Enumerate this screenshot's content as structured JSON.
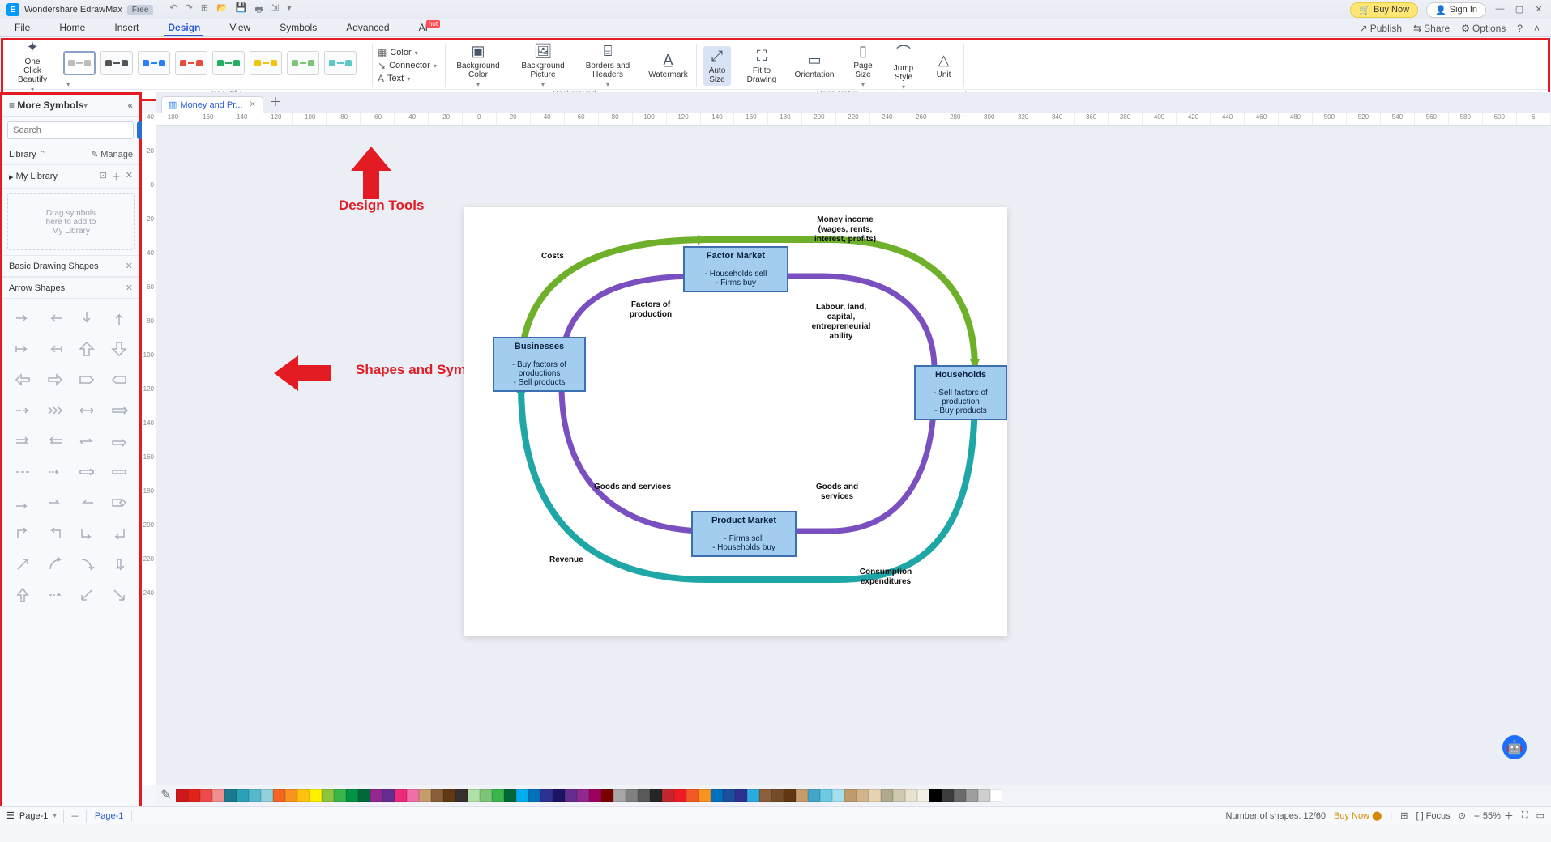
{
  "titlebar": {
    "app_name": "Wondershare EdrawMax",
    "free_badge": "Free",
    "buy_now": "Buy Now",
    "sign_in": "Sign In"
  },
  "menubar": {
    "items": [
      "File",
      "Home",
      "Insert",
      "Design",
      "View",
      "Symbols",
      "Advanced",
      "AI"
    ],
    "active_index": 3,
    "hot_index": 7,
    "right": {
      "publish": "Publish",
      "share": "Share",
      "options": "Options"
    }
  },
  "ribbon": {
    "one_click": "One Click\nBeautify",
    "color": "Color",
    "connector": "Connector",
    "text": "Text",
    "background_color": "Background\nColor",
    "background_picture": "Background\nPicture",
    "borders_headers": "Borders and\nHeaders",
    "watermark": "Watermark",
    "auto_size": "Auto\nSize",
    "fit_drawing": "Fit to\nDrawing",
    "orientation": "Orientation",
    "page_size": "Page\nSize",
    "jump_style": "Jump\nStyle",
    "unit": "Unit",
    "group_labels": {
      "beautify": "Beautify",
      "background": "Background",
      "page_setup": "Page Setup"
    }
  },
  "side_panel": {
    "title": "More Symbols",
    "search_placeholder": "Search",
    "search_btn": "Search",
    "library": "Library",
    "manage": "Manage",
    "my_library": "My Library",
    "drop_hint": "Drag symbols\nhere to add to\nMy Library",
    "basic_shapes": "Basic Drawing Shapes",
    "arrow_shapes": "Arrow Shapes"
  },
  "tabs": {
    "doc_name": "Money and Pr..."
  },
  "hruler_vals": [
    "180",
    "-160",
    "-140",
    "-120",
    "-100",
    "-80",
    "-60",
    "-40",
    "-20",
    "0",
    "20",
    "40",
    "60",
    "80",
    "100",
    "120",
    "140",
    "160",
    "180",
    "200",
    "220",
    "240",
    "260",
    "280",
    "300",
    "320",
    "340",
    "360",
    "380",
    "400",
    "420",
    "440",
    "460",
    "480",
    "500",
    "520",
    "540",
    "560",
    "580",
    "600",
    "6"
  ],
  "vruler_vals": [
    "-40",
    "-20",
    "0",
    "20",
    "40",
    "60",
    "80",
    "100",
    "120",
    "140",
    "160",
    "180",
    "200",
    "220",
    "240"
  ],
  "annotations": {
    "design_tools": "Design Tools",
    "shapes_symbols": "Shapes and Symbols"
  },
  "diagram": {
    "factor_market": {
      "title": "Factor Market",
      "l1": "- Households sell",
      "l2": "- Firms buy"
    },
    "businesses": {
      "title": "Businesses",
      "l1": "- Buy factors of",
      "l2": "productions",
      "l3": "- Sell products"
    },
    "households": {
      "title": "Households",
      "l1": "- Sell factors of",
      "l2": "production",
      "l3": "- Buy products"
    },
    "product_market": {
      "title": "Product Market",
      "l1": "- Firms sell",
      "l2": "- Households buy"
    },
    "labels": {
      "money_income": "Money income\n(wages, rents,\ninterest, profits)",
      "costs": "Costs",
      "factors_prod": "Factors of\nproduction",
      "labour": "Labour, land,\ncapital,\nentrepreneurial\nability",
      "goods_services_l": "Goods and services",
      "goods_services_r": "Goods and\nservices",
      "revenue": "Revenue",
      "consumption": "Consumption\nexpenditures"
    }
  },
  "status": {
    "shapes_count": "Number of shapes: 12/60",
    "buy_now": "Buy Now",
    "focus": "Focus",
    "zoom": "55%"
  },
  "page_selector": {
    "current": "Page-1",
    "tab": "Page-1"
  },
  "colors": [
    "#ce181e",
    "#e2231a",
    "#ef4b4b",
    "#f18e8e",
    "#1b7a8c",
    "#2aa1b7",
    "#56b8cb",
    "#8fd1dc",
    "#f26522",
    "#f7931e",
    "#ffc20e",
    "#fff200",
    "#8cc63f",
    "#39b54a",
    "#009444",
    "#006838",
    "#92278f",
    "#662d91",
    "#ee2a7b",
    "#f06eaa",
    "#c69c6d",
    "#8a5d3b",
    "#603913",
    "#362f2d",
    "#b0e0a8",
    "#7cc576",
    "#39b54a",
    "#006838",
    "#00aeef",
    "#0072bc",
    "#2e3192",
    "#1b1464",
    "#662d91",
    "#92278f",
    "#9e005d",
    "#790000",
    "#a6a6a6",
    "#808080",
    "#595959",
    "#262626",
    "#c1272d",
    "#ed1c24",
    "#f15a24",
    "#f7931e",
    "#0071bc",
    "#1b4f9c",
    "#2e3192",
    "#29abe2",
    "#8b5e3c",
    "#754c29",
    "#603813",
    "#c69c6d",
    "#42a5c9",
    "#6ccbe2",
    "#a3e0ef",
    "#c09a6b",
    "#d2b48c",
    "#e6d3b3",
    "#b0a990",
    "#cfc9b0",
    "#e7e3d0",
    "#f3f1e6",
    "#000000",
    "#3c3c3c",
    "#6b6b6b",
    "#9e9e9e",
    "#cfcfcf",
    "#ffffff"
  ]
}
